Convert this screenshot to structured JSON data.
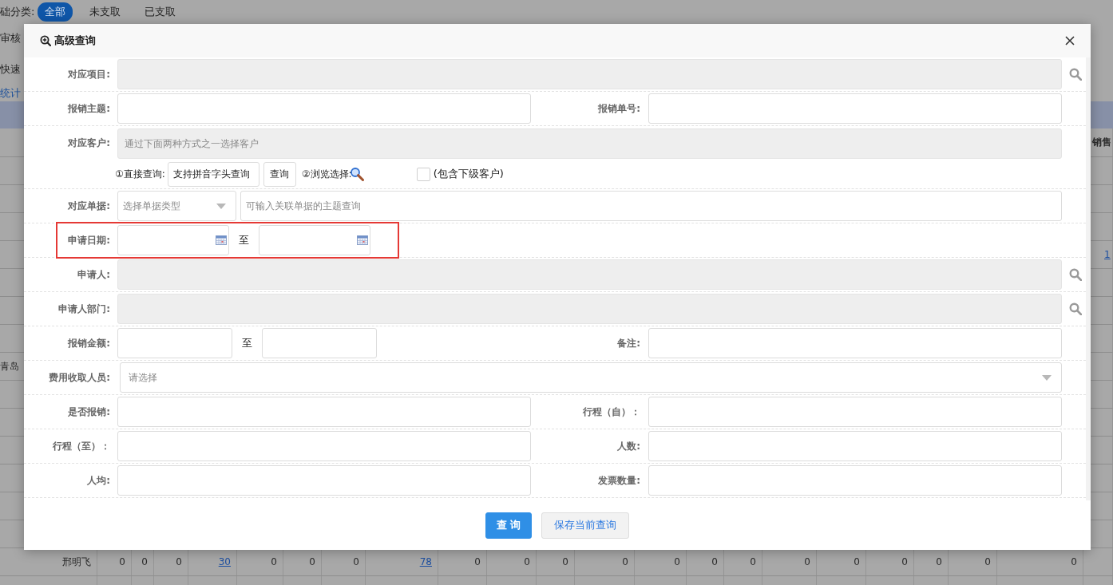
{
  "filter": {
    "label": "础分类:",
    "options": [
      {
        "label": "全部",
        "selected": true
      },
      {
        "label": "未支取",
        "selected": false
      },
      {
        "label": "已支取",
        "selected": false
      }
    ]
  },
  "side_labels": [
    {
      "text": "审核",
      "kind": "plain"
    },
    {
      "text": "快速",
      "kind": "plain"
    },
    {
      "text": "统计",
      "kind": "link"
    }
  ],
  "table": {
    "header_last": "销售",
    "rows": [
      {},
      {},
      {},
      {
        "last": {
          "text": "1",
          "link": true
        }
      },
      {},
      {},
      {},
      {
        "name": "青岛"
      },
      {},
      {},
      {},
      {},
      {},
      {},
      {
        "name": "邢明飞",
        "values": [
          {
            "text": "0",
            "link": false
          },
          {
            "text": "0",
            "link": false
          },
          {
            "text": "0",
            "link": false
          },
          {
            "text": "30",
            "link": true
          },
          {
            "text": "0",
            "link": false
          },
          {
            "text": "0",
            "link": false
          },
          {
            "text": "0",
            "link": false
          },
          {
            "text": "78",
            "link": true
          },
          {
            "text": "0",
            "link": false
          },
          {
            "text": "0",
            "link": false
          },
          {
            "text": "0",
            "link": false
          },
          {
            "text": "0",
            "link": false
          },
          {
            "text": "0",
            "link": false
          },
          {
            "text": "0",
            "link": false
          },
          {
            "text": "0",
            "link": false
          },
          {
            "text": "0",
            "link": false
          },
          {
            "text": "0",
            "link": false
          },
          {
            "text": "0",
            "link": false
          },
          {
            "text": "0",
            "link": false
          },
          {
            "text": "0",
            "link": false
          },
          {
            "text": "0",
            "link": false
          }
        ]
      },
      {}
    ]
  },
  "dialog": {
    "title": "高级查询",
    "rows": [
      {
        "kind": "lookup",
        "label": "对应项目:"
      },
      {
        "kind": "pair",
        "items": [
          {
            "label": "报销主题:"
          },
          {
            "label": "报销单号:"
          }
        ]
      },
      {
        "kind": "customer",
        "label": "对应客户:",
        "placeholder": "通过下面两种方式之一选择客户",
        "direct_label": "①直接查询:",
        "direct_value": "支持拼音字头查询",
        "query_button": "查询",
        "browse_label": "②浏览选择:",
        "include_sub": {
          "label": "(包含下级客户)",
          "checked": false
        }
      },
      {
        "kind": "doc",
        "label": "对应单据:",
        "type_placeholder": "选择单据类型",
        "keyword_placeholder": "可输入关联单据的主题查询"
      },
      {
        "kind": "date_range",
        "label": "申请日期:",
        "separator": "至",
        "highlighted": true
      },
      {
        "kind": "lookup",
        "label": "申请人:"
      },
      {
        "kind": "lookup",
        "label": "申请人部门:"
      },
      {
        "kind": "number_range",
        "label": "报销金额:",
        "separator": "至",
        "side_label": "备注:"
      },
      {
        "kind": "select",
        "label": "费用收取人员:",
        "placeholder": "请选择"
      },
      {
        "kind": "pair",
        "items": [
          {
            "label": "是否报销:"
          },
          {
            "label": "行程（自）："
          }
        ]
      },
      {
        "kind": "pair",
        "items": [
          {
            "label": "行程（至）："
          },
          {
            "label": "人数:"
          }
        ]
      },
      {
        "kind": "pair",
        "items": [
          {
            "label": "人均:"
          },
          {
            "label": "发票数量:"
          }
        ]
      }
    ],
    "buttons": [
      {
        "label": "查 询",
        "kind": "primary"
      },
      {
        "label": "保存当前查询",
        "kind": "secondary"
      }
    ]
  }
}
